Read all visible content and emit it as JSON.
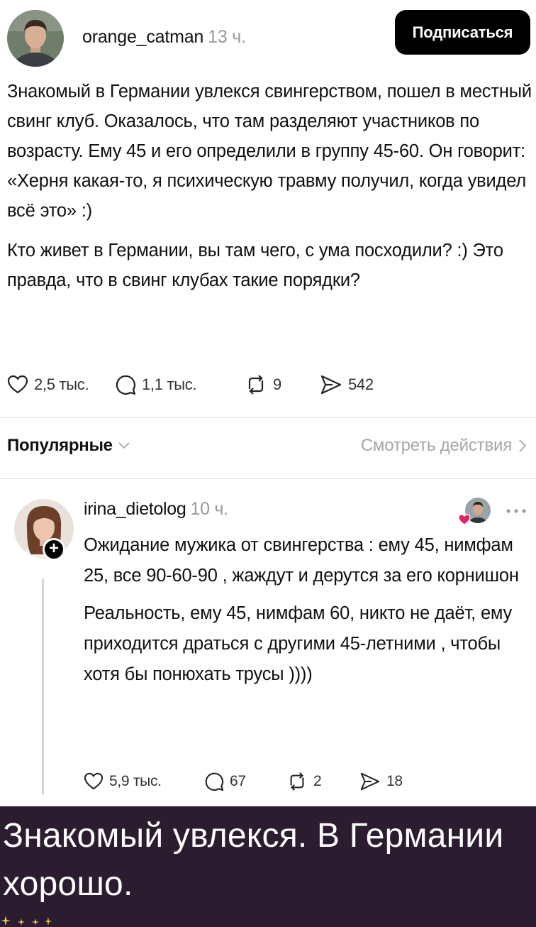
{
  "post": {
    "author": "orange_catman",
    "time": "13 ч.",
    "subscribe_label": "Подписаться",
    "paragraphs": [
      "Знакомый в Германии увлекся свингерством, пошел в местный свинг клуб. Оказалось, что там разделяют участников по возрасту. Ему 45 и его определили в группу 45-60. Он говорит: «Херня какая-то, я психическую травму получил, когда увидел всё это» :)",
      "Кто живет в Германии, вы там чего, с ума посходили? :) Это правда, что в свинг клубах такие порядки?"
    ],
    "stats": {
      "likes": "2,5 тыс.",
      "replies": "1,1 тыс.",
      "reposts": "9",
      "shares": "542"
    },
    "icons": [
      "heart-icon",
      "comment-icon",
      "repost-icon",
      "share-icon"
    ]
  },
  "sort": {
    "label": "Популярные",
    "view_actions": "Смотреть действия"
  },
  "comment": {
    "author": "irina_dietolog",
    "time": "10 ч.",
    "paragraphs": [
      "Ожидание мужика от свингерства : ему 45, нимфам 25, все 90-60-90 , жаждут и дерутся за его корнишон",
      "Реальность, ему 45, нимфам 60, никто не даёт, ему приходится драться с другими 45-летними , чтобы хотя бы понюхать трусы ))))"
    ],
    "stats": {
      "likes": "5,9 тыс.",
      "replies": "67",
      "reposts": "2",
      "shares": "18"
    }
  },
  "caption": {
    "text": "Знакомый увлекся. В Германии хорошо."
  },
  "colors": {
    "caption_background": "#2c1c30",
    "button_background": "#000000",
    "muted_text": "#9a9a9a",
    "heart_badge": "#e0245e"
  }
}
